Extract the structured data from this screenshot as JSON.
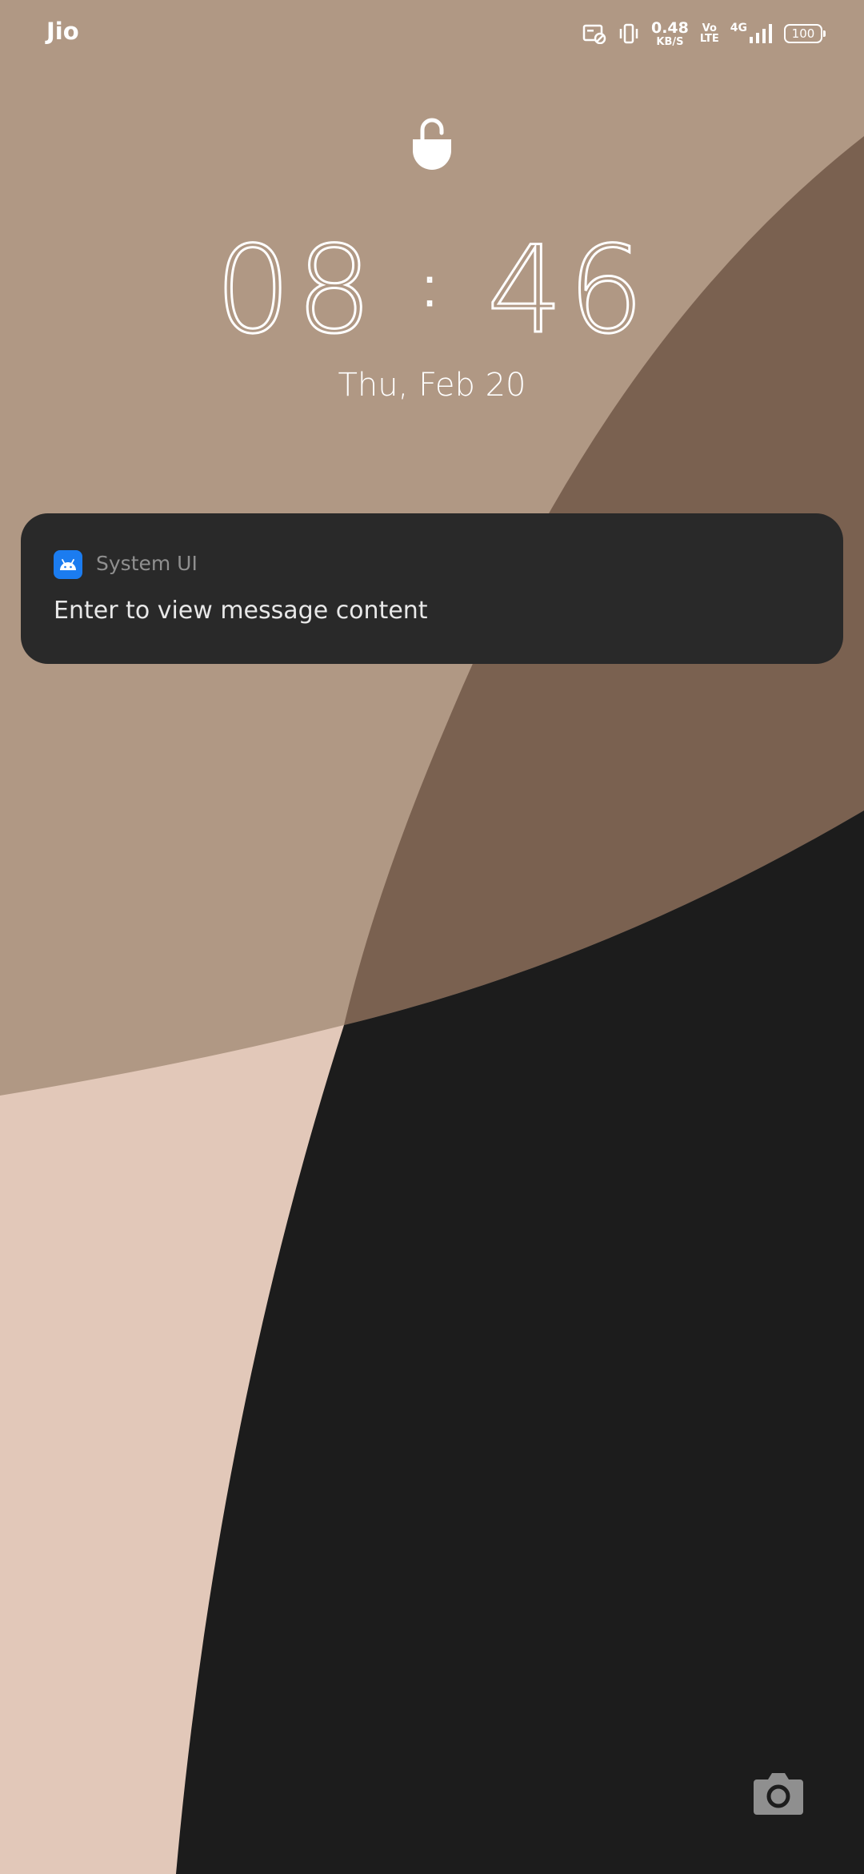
{
  "status_bar": {
    "carrier": "Jio",
    "net_speed_value": "0.48",
    "net_speed_unit": "KB/S",
    "volte_top": "Vo",
    "volte_bottom": "LTE",
    "network_type": "4G",
    "battery": "100",
    "icons": [
      "screen-cast-off-icon",
      "vibrate-icon",
      "signal-icon",
      "battery-icon"
    ]
  },
  "lock": {
    "icon": "unlocked-padlock-icon"
  },
  "clock": {
    "hours": "08",
    "separator": ":",
    "minutes": "46"
  },
  "date": "Thu, Feb 20",
  "notification": {
    "app_icon": "android-icon",
    "app_name": "System UI",
    "message": "Enter to view message content"
  },
  "shortcuts": {
    "camera_icon": "camera-icon"
  },
  "colors": {
    "wallpaper_light_brown": "#b09884",
    "wallpaper_dark_brown": "#7a6150",
    "wallpaper_peach": "#e2c8b9",
    "wallpaper_black": "#1c1c1c",
    "notification_bg": "#292929",
    "app_icon_blue": "#1b7cf0"
  }
}
